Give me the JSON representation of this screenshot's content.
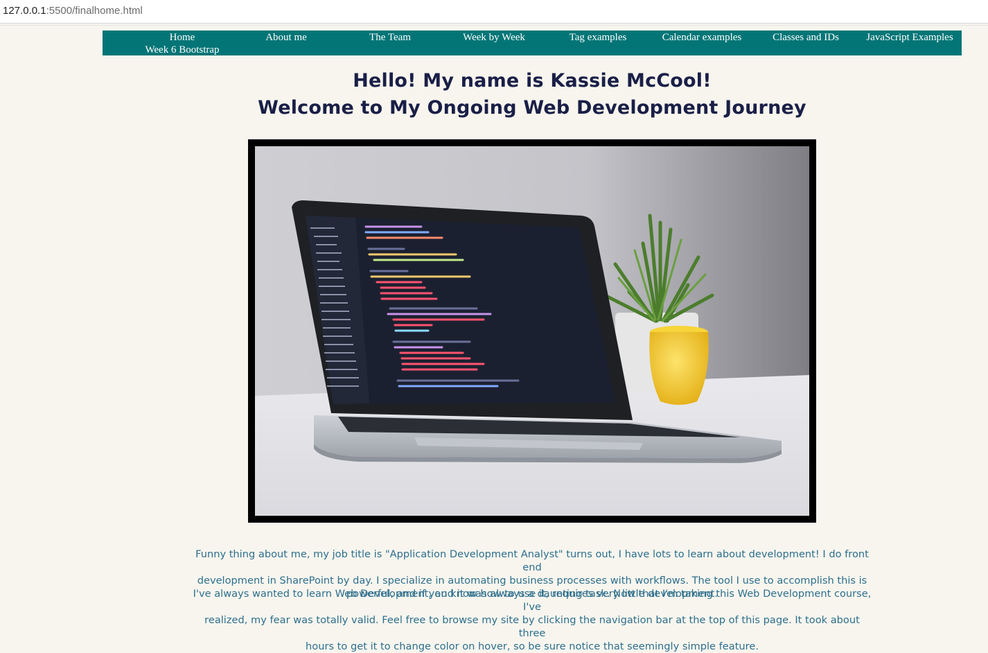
{
  "browser": {
    "url_host": "127.0.0.1",
    "url_rest": ":5500/finalhome.html"
  },
  "nav": {
    "items": [
      {
        "label": "Home"
      },
      {
        "label": "About me"
      },
      {
        "label": "The Team"
      },
      {
        "label": "Week by Week"
      },
      {
        "label": "Tag examples"
      },
      {
        "label": "Calendar examples"
      },
      {
        "label": "Classes and IDs"
      },
      {
        "label": "JavaScript Examples"
      },
      {
        "label": "Week 6 Bootstrap"
      }
    ]
  },
  "hero": {
    "line1": "Hello! My name is Kassie McCool!",
    "line2": "Welcome to My Ongoing Web Development Journey"
  },
  "intro": {
    "p1_line1": "Funny thing about me, my job title is \"Application Development Analyst\" turns out, I have lots to learn about development! I do front end",
    "p1_line2": "development in SharePoint by day. I specialize in automating business processes with workflows. The tool I use to accomplish this is",
    "p1_line3": "powerful, and if you know how to use it, requires very little development.",
    "p2_line1": "I've always wanted to learn Web Development, and it was always a daunting task. Now that I'm taking this Web Development course, I've",
    "p2_line2": "realized, my fear was totally valid. Feel free to browse my site by clicking the navigation bar at the top of this page. It took about three",
    "p2_line3": "hours to get it to change color on hover, so be sure notice that seemingly simple feature."
  },
  "colors": {
    "nav_bg": "#047576",
    "heading": "#1a1f47",
    "paragraph": "#2e6f8d",
    "page_bg": "#f7f5ee"
  }
}
